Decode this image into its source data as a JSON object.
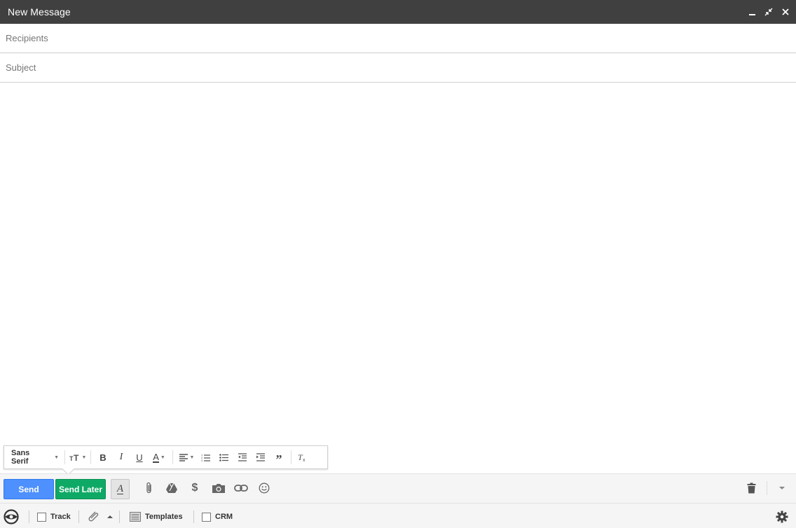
{
  "window": {
    "title": "New Message",
    "controls": [
      "minimize-icon",
      "pop-out-icon",
      "close-icon"
    ]
  },
  "fields": {
    "recipients_placeholder": "Recipients",
    "subject_placeholder": "Subject"
  },
  "format_toolbar": {
    "font": "Sans Serif",
    "items": [
      "font-size-icon",
      "bold-icon",
      "italic-icon",
      "underline-icon",
      "text-color-icon",
      "align-icon",
      "numbered-list-icon",
      "bulleted-list-icon",
      "indent-less-icon",
      "indent-more-icon",
      "quote-icon",
      "remove-formatting-icon"
    ]
  },
  "action_bar": {
    "send_label": "Send",
    "send_later_label": "Send Later",
    "send_color": "#4d90fe",
    "send_later_color": "#0fa966",
    "icons": [
      "attach-icon",
      "drive-icon",
      "dollar-icon",
      "photo-icon",
      "link-icon",
      "emoji-icon",
      "trash-icon",
      "more-options-icon"
    ]
  },
  "status_bar": {
    "track_label": "Track",
    "templates_label": "Templates",
    "crm_label": "CRM",
    "icons": [
      "boomerang-logo-icon",
      "attachment-reminder-icon",
      "settings-icon"
    ]
  }
}
